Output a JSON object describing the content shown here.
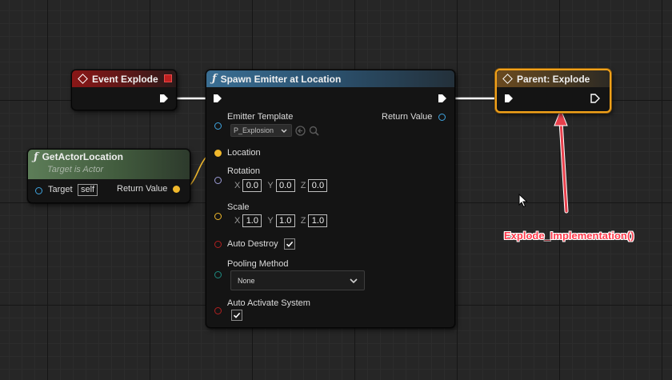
{
  "nodes": {
    "event_explode": {
      "title": "Event Explode"
    },
    "spawn_emitter": {
      "title": "Spawn Emitter at Location",
      "emitter_template_label": "Emitter Template",
      "emitter_template_value": "P_Explosion",
      "return_value_label": "Return Value",
      "location_label": "Location",
      "rotation_label": "Rotation",
      "rotation": {
        "x": "0.0",
        "y": "0.0",
        "z": "0.0"
      },
      "scale_label": "Scale",
      "scale": {
        "x": "1.0",
        "y": "1.0",
        "z": "1.0"
      },
      "auto_destroy_label": "Auto Destroy",
      "auto_destroy_checked": true,
      "pooling_method_label": "Pooling Method",
      "pooling_method_value": "None",
      "auto_activate_label": "Auto Activate System",
      "auto_activate_checked": true
    },
    "get_actor_location": {
      "title": "GetActorLocation",
      "subtitle": "Target is Actor",
      "target_label": "Target",
      "target_value": "self",
      "return_value_label": "Return Value"
    },
    "parent_explode": {
      "title": "Parent: Explode"
    }
  },
  "axis_labels": {
    "x": "X",
    "y": "Y",
    "z": "Z"
  },
  "annotation": {
    "text": "Explode_Implementation()"
  },
  "colors": {
    "event_header": "#8a1717",
    "function_header": "#3a6e93",
    "pure_header": "#5d7d58",
    "parent_highlight": "#f2a21a",
    "annotation_red": "#ff3b4c",
    "exec_wire": "#ffffff",
    "vector_wire": "#f0b82c"
  },
  "icons": {
    "event": "diamond-icon",
    "function": "function-f-icon",
    "close": "red-square-icon",
    "cursor": "mouse-cursor-icon"
  }
}
